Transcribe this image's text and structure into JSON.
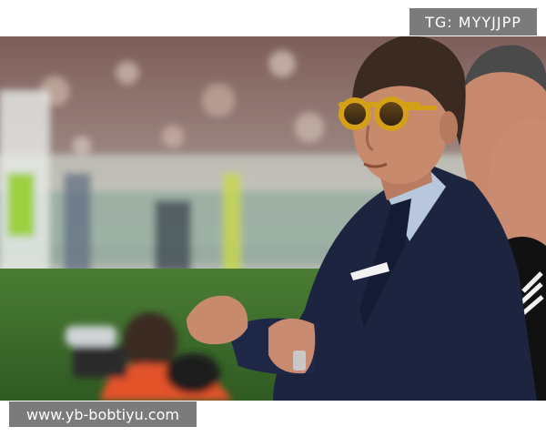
{
  "watermarks": {
    "top_label": "TG: MYYJJPP",
    "bottom_label": "www.yb-bobtiyu.com"
  },
  "photo": {
    "subject": "man-in-navy-suit-with-yellow-sunglasses",
    "colors": {
      "pitch": "#3c6b2a",
      "stands": "#8a6a66",
      "suit": "#1c2440",
      "skin": "#c78a6d",
      "sunglasses": "#d4a017",
      "shirt": "#b9c7dc",
      "tie": "#141b33"
    }
  }
}
